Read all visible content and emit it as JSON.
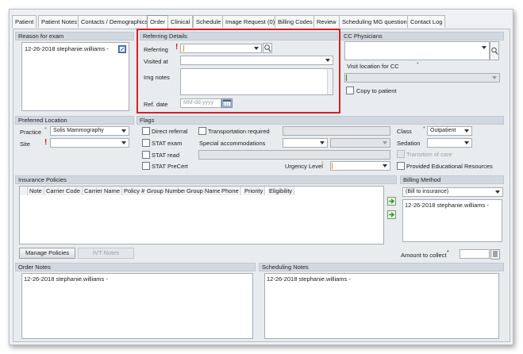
{
  "tabs": [
    {
      "label": "Patient",
      "active": false
    },
    {
      "label": "Patient Notes",
      "active": false
    },
    {
      "label": "Contacts / Demographics",
      "active": false
    },
    {
      "label": "Order",
      "active": true
    },
    {
      "label": "Clinical",
      "active": false
    },
    {
      "label": "Schedule",
      "active": false
    },
    {
      "label": "Image Request (0)",
      "active": false
    },
    {
      "label": "Billing Codes",
      "active": false
    },
    {
      "label": "Review",
      "active": false
    },
    {
      "label": "Scheduling MG questions",
      "active": false
    },
    {
      "label": "Contact Log",
      "active": false
    }
  ],
  "reason": {
    "header": "Reason for exam",
    "text": "12-26-2018 stephanie.williams -",
    "icon": "edit-note-icon"
  },
  "referring": {
    "header": "Referring Details",
    "referring_label": "Referring",
    "visited_at_label": "Visited at",
    "img_notes_label": "Img notes",
    "ref_date_label": "Ref. date",
    "ref_date_placeholder": "MM-dd-yyyy",
    "search_icon": "search-icon",
    "calendar_icon": "calendar-icon"
  },
  "cc": {
    "header": "CC Physicians",
    "visit_location_label": "Visit location for CC",
    "copy_to_patient_label": "Copy to patient"
  },
  "preferred_location": {
    "header": "Preferred Location",
    "practice_label": "Practice",
    "practice_value": "Solis Mammography",
    "site_label": "Site",
    "site_value": ""
  },
  "flags": {
    "header": "Flags",
    "direct_referral": "Direct referral",
    "transportation_required": "Transportation required",
    "stat_exam": "STAT exam",
    "special_accommodations": "Special accommodations",
    "stat_read": "STAT read",
    "stat_precert": "STAT PreCert",
    "urgency_level_label": "Urgency Level",
    "class_label": "Class",
    "class_value": "Outpatient",
    "sedation_label": "Sedation",
    "transition_of_care": "Transition of care",
    "provided_educational_resources": "Provided Educational Resources"
  },
  "insurance": {
    "header": "Insurance Policies",
    "columns": [
      "Note",
      "Carrier Code",
      "Carrier Name",
      "Policy #",
      "Group Number",
      "Group Name",
      "Phone",
      "Priority",
      "Eligibility"
    ],
    "manage_policies": "Manage Policies",
    "ivt_notes": "IVT Notes",
    "up_icon": "move-up-icon",
    "down_icon": "move-down-icon"
  },
  "billing": {
    "header": "Billing Method",
    "method_value": "(Bill to insurance)",
    "notes_text": "12-26-2018 stephanie.williams -",
    "amount_label": "Amount to collect",
    "calc_icon": "calculator-icon"
  },
  "order_notes": {
    "header": "Order Notes",
    "text": "12-26-2018 stephanie.williams -"
  },
  "scheduling_notes": {
    "header": "Scheduling Notes",
    "text": "12-26-2018 stephanie.williams -"
  },
  "colors": {
    "highlight": "#d42026",
    "required": "#d2121a",
    "required_star": "#2a8a2a",
    "accent_orange": "#e8892b"
  }
}
